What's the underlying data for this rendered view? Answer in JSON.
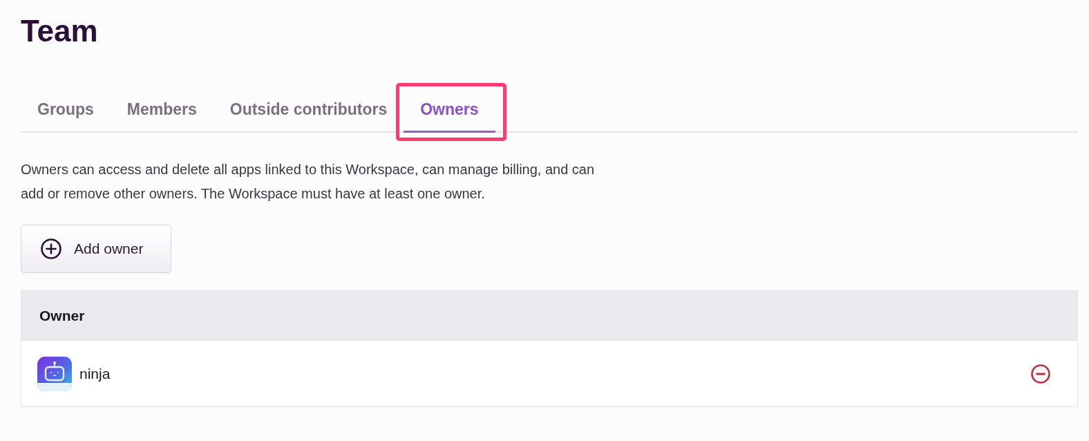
{
  "page": {
    "title": "Team"
  },
  "tabs": [
    {
      "label": "Groups",
      "selected": false,
      "highlighted": false
    },
    {
      "label": "Members",
      "selected": false,
      "highlighted": false
    },
    {
      "label": "Outside contributors",
      "selected": false,
      "highlighted": false
    },
    {
      "label": "Owners",
      "selected": true,
      "highlighted": true
    }
  ],
  "description": "Owners can access and delete all apps linked to this Workspace, can manage billing, and can add or remove other owners. The Workspace must have at least one owner.",
  "add_button": {
    "label": "Add owner"
  },
  "table": {
    "columns": [
      "Owner"
    ],
    "rows": [
      {
        "name": "ninja"
      }
    ]
  }
}
